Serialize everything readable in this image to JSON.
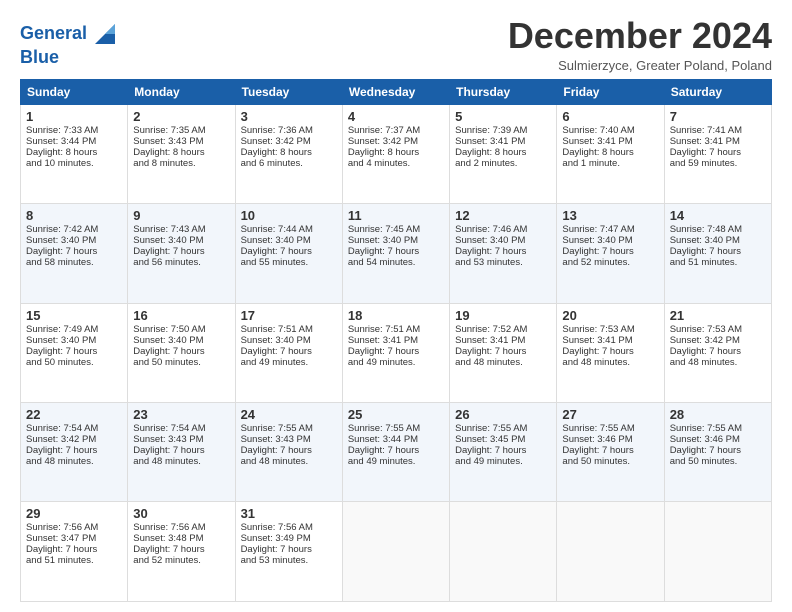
{
  "header": {
    "logo_line1": "General",
    "logo_line2": "Blue",
    "title": "December 2024",
    "subtitle": "Sulmierzyce, Greater Poland, Poland"
  },
  "columns": [
    "Sunday",
    "Monday",
    "Tuesday",
    "Wednesday",
    "Thursday",
    "Friday",
    "Saturday"
  ],
  "weeks": [
    [
      {
        "day": "1",
        "line1": "Sunrise: 7:33 AM",
        "line2": "Sunset: 3:44 PM",
        "line3": "Daylight: 8 hours",
        "line4": "and 10 minutes."
      },
      {
        "day": "2",
        "line1": "Sunrise: 7:35 AM",
        "line2": "Sunset: 3:43 PM",
        "line3": "Daylight: 8 hours",
        "line4": "and 8 minutes."
      },
      {
        "day": "3",
        "line1": "Sunrise: 7:36 AM",
        "line2": "Sunset: 3:42 PM",
        "line3": "Daylight: 8 hours",
        "line4": "and 6 minutes."
      },
      {
        "day": "4",
        "line1": "Sunrise: 7:37 AM",
        "line2": "Sunset: 3:42 PM",
        "line3": "Daylight: 8 hours",
        "line4": "and 4 minutes."
      },
      {
        "day": "5",
        "line1": "Sunrise: 7:39 AM",
        "line2": "Sunset: 3:41 PM",
        "line3": "Daylight: 8 hours",
        "line4": "and 2 minutes."
      },
      {
        "day": "6",
        "line1": "Sunrise: 7:40 AM",
        "line2": "Sunset: 3:41 PM",
        "line3": "Daylight: 8 hours",
        "line4": "and 1 minute."
      },
      {
        "day": "7",
        "line1": "Sunrise: 7:41 AM",
        "line2": "Sunset: 3:41 PM",
        "line3": "Daylight: 7 hours",
        "line4": "and 59 minutes."
      }
    ],
    [
      {
        "day": "8",
        "line1": "Sunrise: 7:42 AM",
        "line2": "Sunset: 3:40 PM",
        "line3": "Daylight: 7 hours",
        "line4": "and 58 minutes."
      },
      {
        "day": "9",
        "line1": "Sunrise: 7:43 AM",
        "line2": "Sunset: 3:40 PM",
        "line3": "Daylight: 7 hours",
        "line4": "and 56 minutes."
      },
      {
        "day": "10",
        "line1": "Sunrise: 7:44 AM",
        "line2": "Sunset: 3:40 PM",
        "line3": "Daylight: 7 hours",
        "line4": "and 55 minutes."
      },
      {
        "day": "11",
        "line1": "Sunrise: 7:45 AM",
        "line2": "Sunset: 3:40 PM",
        "line3": "Daylight: 7 hours",
        "line4": "and 54 minutes."
      },
      {
        "day": "12",
        "line1": "Sunrise: 7:46 AM",
        "line2": "Sunset: 3:40 PM",
        "line3": "Daylight: 7 hours",
        "line4": "and 53 minutes."
      },
      {
        "day": "13",
        "line1": "Sunrise: 7:47 AM",
        "line2": "Sunset: 3:40 PM",
        "line3": "Daylight: 7 hours",
        "line4": "and 52 minutes."
      },
      {
        "day": "14",
        "line1": "Sunrise: 7:48 AM",
        "line2": "Sunset: 3:40 PM",
        "line3": "Daylight: 7 hours",
        "line4": "and 51 minutes."
      }
    ],
    [
      {
        "day": "15",
        "line1": "Sunrise: 7:49 AM",
        "line2": "Sunset: 3:40 PM",
        "line3": "Daylight: 7 hours",
        "line4": "and 50 minutes."
      },
      {
        "day": "16",
        "line1": "Sunrise: 7:50 AM",
        "line2": "Sunset: 3:40 PM",
        "line3": "Daylight: 7 hours",
        "line4": "and 50 minutes."
      },
      {
        "day": "17",
        "line1": "Sunrise: 7:51 AM",
        "line2": "Sunset: 3:40 PM",
        "line3": "Daylight: 7 hours",
        "line4": "and 49 minutes."
      },
      {
        "day": "18",
        "line1": "Sunrise: 7:51 AM",
        "line2": "Sunset: 3:41 PM",
        "line3": "Daylight: 7 hours",
        "line4": "and 49 minutes."
      },
      {
        "day": "19",
        "line1": "Sunrise: 7:52 AM",
        "line2": "Sunset: 3:41 PM",
        "line3": "Daylight: 7 hours",
        "line4": "and 48 minutes."
      },
      {
        "day": "20",
        "line1": "Sunrise: 7:53 AM",
        "line2": "Sunset: 3:41 PM",
        "line3": "Daylight: 7 hours",
        "line4": "and 48 minutes."
      },
      {
        "day": "21",
        "line1": "Sunrise: 7:53 AM",
        "line2": "Sunset: 3:42 PM",
        "line3": "Daylight: 7 hours",
        "line4": "and 48 minutes."
      }
    ],
    [
      {
        "day": "22",
        "line1": "Sunrise: 7:54 AM",
        "line2": "Sunset: 3:42 PM",
        "line3": "Daylight: 7 hours",
        "line4": "and 48 minutes."
      },
      {
        "day": "23",
        "line1": "Sunrise: 7:54 AM",
        "line2": "Sunset: 3:43 PM",
        "line3": "Daylight: 7 hours",
        "line4": "and 48 minutes."
      },
      {
        "day": "24",
        "line1": "Sunrise: 7:55 AM",
        "line2": "Sunset: 3:43 PM",
        "line3": "Daylight: 7 hours",
        "line4": "and 48 minutes."
      },
      {
        "day": "25",
        "line1": "Sunrise: 7:55 AM",
        "line2": "Sunset: 3:44 PM",
        "line3": "Daylight: 7 hours",
        "line4": "and 49 minutes."
      },
      {
        "day": "26",
        "line1": "Sunrise: 7:55 AM",
        "line2": "Sunset: 3:45 PM",
        "line3": "Daylight: 7 hours",
        "line4": "and 49 minutes."
      },
      {
        "day": "27",
        "line1": "Sunrise: 7:55 AM",
        "line2": "Sunset: 3:46 PM",
        "line3": "Daylight: 7 hours",
        "line4": "and 50 minutes."
      },
      {
        "day": "28",
        "line1": "Sunrise: 7:55 AM",
        "line2": "Sunset: 3:46 PM",
        "line3": "Daylight: 7 hours",
        "line4": "and 50 minutes."
      }
    ],
    [
      {
        "day": "29",
        "line1": "Sunrise: 7:56 AM",
        "line2": "Sunset: 3:47 PM",
        "line3": "Daylight: 7 hours",
        "line4": "and 51 minutes."
      },
      {
        "day": "30",
        "line1": "Sunrise: 7:56 AM",
        "line2": "Sunset: 3:48 PM",
        "line3": "Daylight: 7 hours",
        "line4": "and 52 minutes."
      },
      {
        "day": "31",
        "line1": "Sunrise: 7:56 AM",
        "line2": "Sunset: 3:49 PM",
        "line3": "Daylight: 7 hours",
        "line4": "and 53 minutes."
      },
      null,
      null,
      null,
      null
    ]
  ]
}
